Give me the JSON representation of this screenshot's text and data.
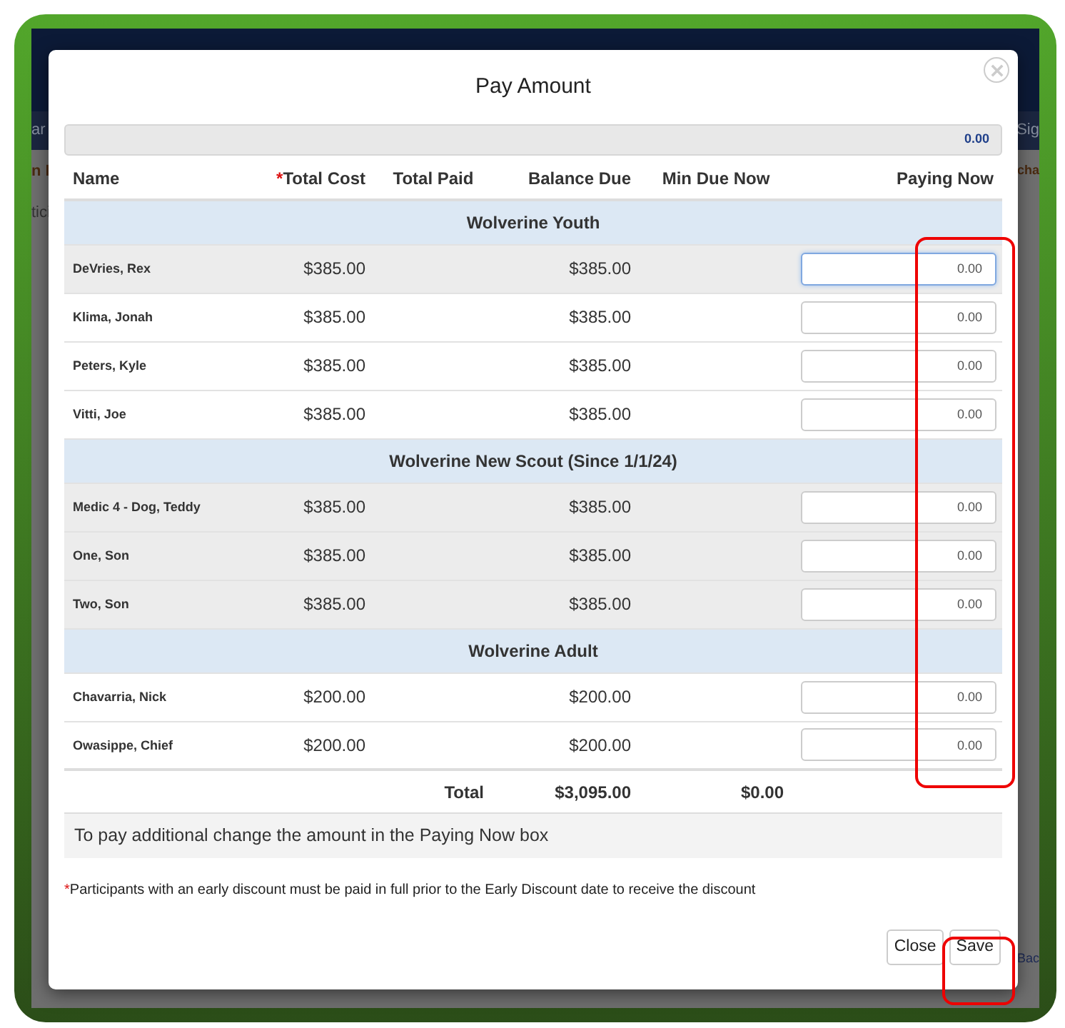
{
  "background_page": {
    "nav_left": "ar",
    "nav_right": "Sig",
    "row_left": "n I",
    "row_right": "cha",
    "tab_left": "tici",
    "footer_right": "Bac"
  },
  "dialog": {
    "title": "Pay Amount",
    "summary_total": "0.00",
    "columns": [
      {
        "label": "Name"
      },
      {
        "label": "Total Cost",
        "mark": "*"
      },
      {
        "label": "Total Paid"
      },
      {
        "label": "Balance Due"
      },
      {
        "label": "Min Due Now"
      },
      {
        "label": "Paying Now"
      }
    ],
    "groups": [
      {
        "title": "Wolverine Youth",
        "rows": [
          {
            "name": "DeVries, Rex",
            "total_cost": "$385.00",
            "balance_due": "$385.00",
            "paying_now": "0.00",
            "shaded": true,
            "focused": true
          },
          {
            "name": "Klima, Jonah",
            "total_cost": "$385.00",
            "balance_due": "$385.00",
            "paying_now": "0.00",
            "shaded": false,
            "focused": false
          },
          {
            "name": "Peters, Kyle",
            "total_cost": "$385.00",
            "balance_due": "$385.00",
            "paying_now": "0.00",
            "shaded": false,
            "focused": false
          },
          {
            "name": "Vitti, Joe",
            "total_cost": "$385.00",
            "balance_due": "$385.00",
            "paying_now": "0.00",
            "shaded": false,
            "focused": false
          }
        ]
      },
      {
        "title": "Wolverine New Scout (Since 1/1/24)",
        "rows": [
          {
            "name": "Medic 4 - Dog, Teddy",
            "total_cost": "$385.00",
            "balance_due": "$385.00",
            "paying_now": "0.00",
            "shaded": true,
            "focused": false
          },
          {
            "name": "One, Son",
            "total_cost": "$385.00",
            "balance_due": "$385.00",
            "paying_now": "0.00",
            "shaded": true,
            "focused": false
          },
          {
            "name": "Two, Son",
            "total_cost": "$385.00",
            "balance_due": "$385.00",
            "paying_now": "0.00",
            "shaded": true,
            "focused": false
          }
        ]
      },
      {
        "title": "Wolverine Adult",
        "rows": [
          {
            "name": "Chavarria, Nick",
            "total_cost": "$200.00",
            "balance_due": "$200.00",
            "paying_now": "0.00",
            "shaded": false,
            "focused": false
          },
          {
            "name": "Owasippe, Chief",
            "total_cost": "$200.00",
            "balance_due": "$200.00",
            "paying_now": "0.00",
            "shaded": false,
            "focused": false
          }
        ]
      }
    ],
    "totals": {
      "label": "Total",
      "balance_due": "$3,095.00",
      "min_due_now": "$0.00"
    },
    "info": "To pay additional change the amount in the Paying Now box",
    "footnote": {
      "mark": "*",
      "text": "Participants with an early discount must be paid in full prior to the Early Discount date to receive the discount"
    },
    "buttons": [
      {
        "label": "Close"
      },
      {
        "label": "Save"
      }
    ]
  }
}
